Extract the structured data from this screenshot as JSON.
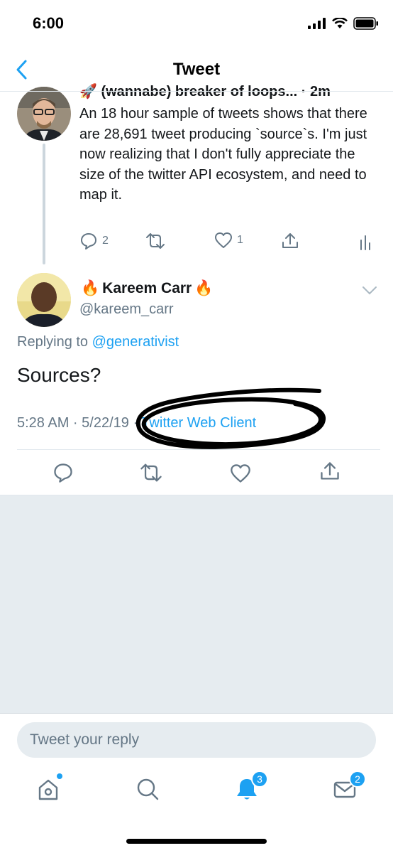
{
  "status_bar": {
    "time": "6:00"
  },
  "header": {
    "title": "Tweet"
  },
  "tweet1": {
    "name_partial": "🚀 (wannabe) breaker of loops... · 2m",
    "text": "An 18 hour sample of tweets shows that there are 28,691 tweet producing `source`s. I'm just now realizing that I don't fully appreciate the size of the twitter API ecosystem, and need to map it.",
    "reply_count": "2",
    "like_count": "1"
  },
  "tweet2": {
    "name": "Kareem Carr",
    "handle": "@kareem_carr",
    "replying_label": "Replying to",
    "replying_to": "@generativist",
    "text": "Sources?",
    "time_date": "5:28 AM · 5/22/19",
    "source": "Twitter Web Client"
  },
  "reply": {
    "placeholder": "Tweet your reply"
  },
  "tabbar": {
    "notifications_badge": "3",
    "messages_badge": "2"
  },
  "colors": {
    "accent": "#1da1f2",
    "muted": "#657786",
    "background_gray": "#e6ecf0"
  }
}
